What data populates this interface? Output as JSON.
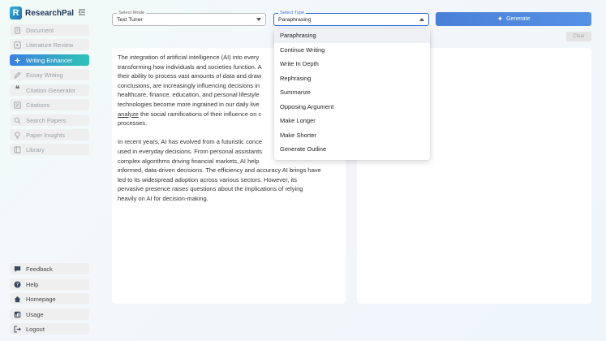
{
  "app": {
    "name": "ResearchPal",
    "logo_letter": "R"
  },
  "sidebar": {
    "items": [
      {
        "label": "Document",
        "icon": "document-icon",
        "active": false
      },
      {
        "label": "Literature Review",
        "icon": "play-square-icon",
        "active": false
      },
      {
        "label": "Writing Enhancer",
        "icon": "sparkle-icon",
        "active": true
      },
      {
        "label": "Essay Writing",
        "icon": "pencil-icon",
        "active": false
      },
      {
        "label": "Citation Generator",
        "icon": "quote-icon",
        "active": false
      },
      {
        "label": "Citations",
        "icon": "citations-icon",
        "active": false
      },
      {
        "label": "Search Papers",
        "icon": "search-icon",
        "active": false
      },
      {
        "label": "Paper Insights",
        "icon": "lightbulb-icon",
        "active": false
      },
      {
        "label": "Library",
        "icon": "library-icon",
        "active": false
      }
    ],
    "bottom_items": [
      {
        "label": "Feedback",
        "icon": "feedback-icon"
      },
      {
        "label": "Help",
        "icon": "help-icon"
      },
      {
        "label": "Homepage",
        "icon": "home-icon"
      },
      {
        "label": "Usage",
        "icon": "usage-icon"
      },
      {
        "label": "Logout",
        "icon": "logout-icon"
      }
    ]
  },
  "controls": {
    "mode": {
      "label": "Select Mode",
      "value": "Text Tuner"
    },
    "type": {
      "label": "Select Type",
      "value": "Paraphrasing"
    },
    "generate_label": "Generate",
    "clear_label": "Clear"
  },
  "type_options": [
    "Paraphrasing",
    "Continue Writing",
    "Write In Depth",
    "Rephrasing",
    "Summarize",
    "Opposing Argument",
    "Make Longer",
    "Make Shorter",
    "Generate Outline"
  ],
  "editor": {
    "p1_lines": [
      "The integration of artificial intelligence (AI) into every",
      "transforming how individuals and societies function. A",
      "their ability to process vast amounts of data and draw",
      "conclusions, are increasingly influencing decisions in",
      "healthcare, finance, education, and personal lifestyle",
      "technologies become more ingrained in our daily live",
      "the social ramifications of their influence on c",
      "processes."
    ],
    "p1_underlined_word": "analyze",
    "p2_lines": [
      "In recent years, AI has evolved from a futuristic conce",
      "used in everyday decisions. From personal assistants",
      "complex algorithms driving financial markets, AI help",
      "informed, data-driven decisions. The efficiency and accuracy AI brings have",
      "led to its widespread adoption across various sectors. However, its",
      "pervasive presence raises questions about the implications of relying",
      "heavily on AI for decision-making."
    ]
  },
  "colors": {
    "accent_blue": "#4a80d8",
    "active_gradient_start": "#3d7fe0",
    "active_gradient_end": "#2ec4b6",
    "focus_border": "#2f6fdb"
  }
}
